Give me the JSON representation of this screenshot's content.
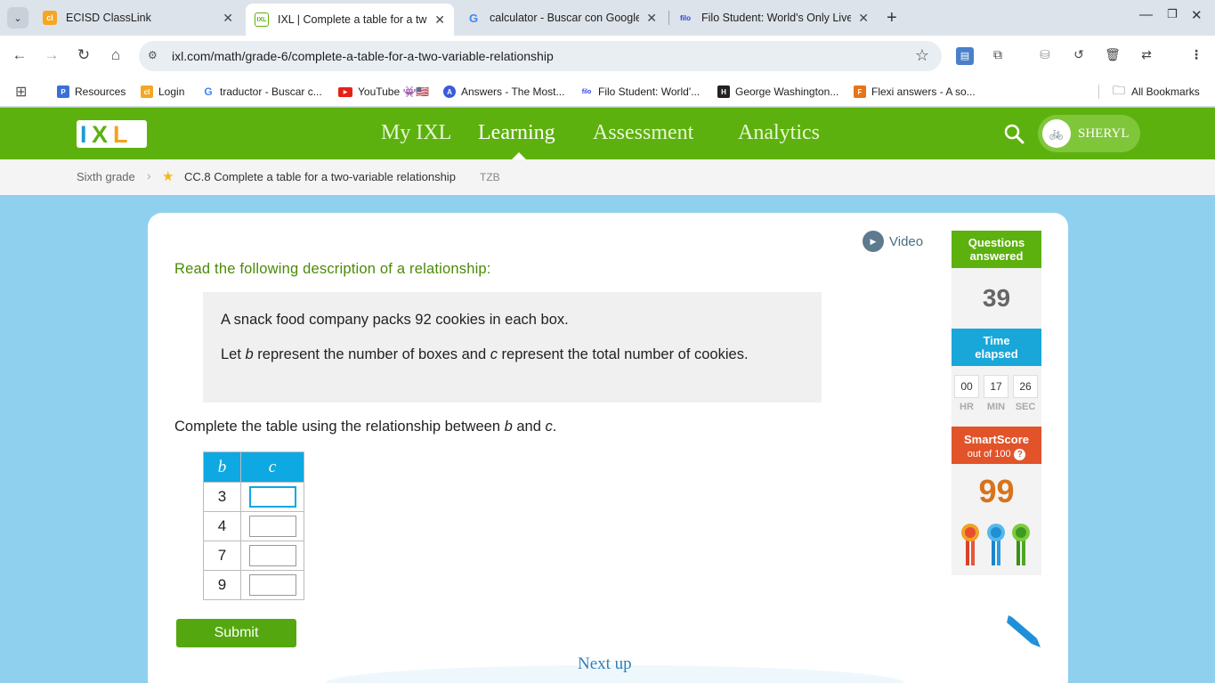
{
  "browser": {
    "tabs": [
      {
        "title": "ECISD ClassLink",
        "favicon": "classlink-icon"
      },
      {
        "title": "IXL | Complete a table for a two-",
        "favicon": "ixl-icon"
      },
      {
        "title": "calculator - Buscar con Google",
        "favicon": "google-icon"
      },
      {
        "title": "Filo Student: World's Only Live I",
        "favicon": "filo-icon"
      }
    ],
    "url": "ixl.com/math/grade-6/complete-a-table-for-a-two-variable-relationship",
    "bookmarks": [
      {
        "label": "Resources",
        "icon": "p",
        "color": "#3b6fd8"
      },
      {
        "label": "Login",
        "icon": "cl",
        "color": "#f5a623"
      },
      {
        "label": "traductor - Buscar c...",
        "icon": "G",
        "color": "#4285f4"
      },
      {
        "label": "YouTube 👾🇺🇸",
        "icon": "▶",
        "color": "#e62117"
      },
      {
        "label": "Answers - The Most...",
        "icon": "A",
        "color": "#3b5bdb"
      },
      {
        "label": "Filo Student: World'...",
        "icon": "filo",
        "color": "#2d3fe0"
      },
      {
        "label": "George Washington...",
        "icon": "H",
        "color": "#222"
      },
      {
        "label": "Flexi answers - A so...",
        "icon": "F",
        "color": "#e8731a"
      }
    ],
    "all_bookmarks": "All Bookmarks"
  },
  "ixl": {
    "logo": "IXL",
    "nav": [
      "My IXL",
      "Learning",
      "Assessment",
      "Analytics"
    ],
    "user": "SHERYL",
    "breadcrumb": {
      "grade": "Sixth grade",
      "skill": "CC.8 Complete a table for a two-variable relationship",
      "code": "TZB"
    }
  },
  "question": {
    "video": "Video",
    "prompt": "Read the following description of a relationship:",
    "desc1": "A snack food company packs 92 cookies in each box.",
    "desc2_a": "Let ",
    "desc2_b": "b",
    "desc2_c": " represent the number of boxes and ",
    "desc2_d": "c",
    "desc2_e": " represent the total number of cookies.",
    "instr_a": "Complete the table using the relationship between ",
    "instr_b": "b",
    "instr_c": " and ",
    "instr_d": "c",
    "instr_e": ".",
    "table": {
      "headers": [
        "b",
        "c"
      ],
      "rows": [
        {
          "b": "3",
          "c": ""
        },
        {
          "b": "4",
          "c": ""
        },
        {
          "b": "7",
          "c": ""
        },
        {
          "b": "9",
          "c": ""
        }
      ]
    },
    "submit": "Submit",
    "next_up": "Next up"
  },
  "stats": {
    "questions_label_1": "Questions",
    "questions_label_2": "answered",
    "questions": "39",
    "time_label_1": "Time",
    "time_label_2": "elapsed",
    "hr": "00",
    "min": "17",
    "sec": "26",
    "hr_lbl": "HR",
    "min_lbl": "MIN",
    "sec_lbl": "SEC",
    "smartscore_label": "SmartScore",
    "smartscore_sub": "out of 100",
    "smartscore": "99"
  }
}
